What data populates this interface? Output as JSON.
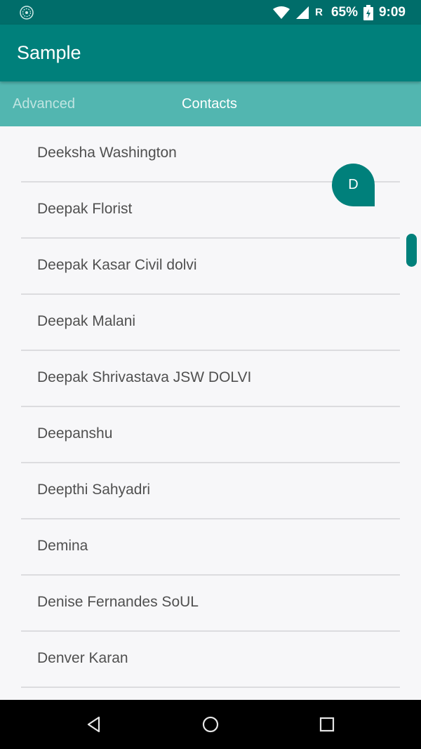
{
  "status_bar": {
    "battery": "65%",
    "roaming": "R",
    "time": "9:09",
    "icons": [
      "app-notification-icon",
      "wifi-icon",
      "signal-icon",
      "battery-charging-icon"
    ]
  },
  "app_bar": {
    "title": "Sample"
  },
  "tabs": [
    {
      "label": "Advanced",
      "selected": false
    },
    {
      "label": "Contacts",
      "selected": true
    }
  ],
  "contacts": [
    "Deeksha Washington",
    "Deepak Florist",
    "Deepak Kasar Civil dolvi",
    "Deepak Malani",
    "Deepak Shrivastava JSW DOLVI",
    "Deepanshu",
    "Deepthi Sahyadri",
    "Demina",
    "Denise Fernandes SoUL",
    "Denver Karan"
  ],
  "fast_scroll": {
    "letter": "D"
  },
  "nav_bar": {
    "buttons": [
      "back-icon",
      "home-icon",
      "recents-icon"
    ]
  },
  "colors": {
    "primary_dark": "#006d6a",
    "primary": "#00807b",
    "tab_bg": "#52b6b0"
  }
}
